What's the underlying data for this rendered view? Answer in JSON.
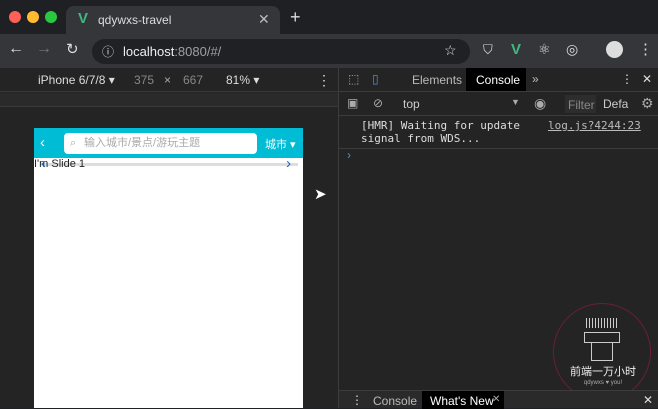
{
  "browser": {
    "tab_title": "qdywxs-travel",
    "url_host": "localhost",
    "url_rest": ":8080/#/"
  },
  "device_toolbar": {
    "device": "iPhone 6/7/8",
    "width": "375",
    "times": "×",
    "height": "667",
    "zoom": "81%"
  },
  "page": {
    "search_placeholder": "输入城市/景点/游玩主题",
    "city_label": "城市",
    "slide_text": "I'm Slide 1"
  },
  "devtools": {
    "tabs": [
      "Elements",
      "Console"
    ],
    "more": "»",
    "context": "top",
    "filter": "Filter",
    "levels": "Defa",
    "log_message": "[HMR] Waiting for update\nsignal from WDS...",
    "log_source": "log.js?4244:23",
    "prompt": "›",
    "drawer_tabs": [
      "Console",
      "What's New"
    ]
  },
  "watermark": {
    "title": "前端一万小时",
    "subtitle": "qdywxs ♥ you!"
  }
}
